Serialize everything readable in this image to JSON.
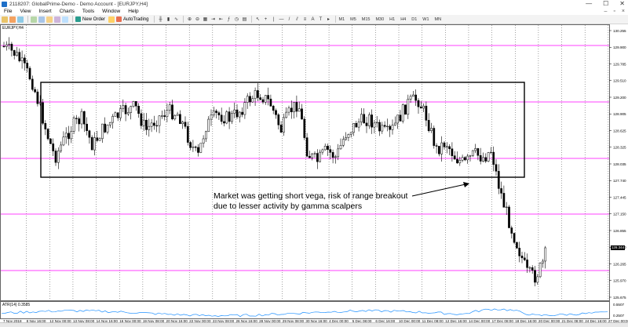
{
  "window": {
    "title": "2118207: GlobalPrime-Demo - Demo Account - [EURJPY,H4]",
    "buttons": [
      "—",
      "☐",
      "✕"
    ]
  },
  "menu": [
    "File",
    "View",
    "Insert",
    "Charts",
    "Tools",
    "Window",
    "Help"
  ],
  "toolbar": {
    "new_order": "New Order",
    "auto_trading": "AutoTrading",
    "timeframes": [
      "M1",
      "M5",
      "M15",
      "M30",
      "H1",
      "H4",
      "D1",
      "W1",
      "MN"
    ]
  },
  "chart": {
    "symbol_label": "EURJPY,H4",
    "indicator_label": "ATR(14) 0.3585",
    "price_ticks": [
      "130.255",
      "129.900",
      "129.785",
      "129.510",
      "129.200",
      "128.905",
      "128.625",
      "128.325",
      "128.035",
      "127.740",
      "127.445",
      "127.150",
      "126.855",
      "126.560",
      "126.265",
      "125.970",
      "125.675"
    ],
    "current_price": "126.344",
    "indicator_ticks": [
      "0.5507",
      "0.2507"
    ],
    "time_ticks": [
      "7 Nov 2018",
      "8 Nov 16:00",
      "12 Nov 00:00",
      "13 Nov 08:00",
      "14 Nov 16:00",
      "16 Nov 00:00",
      "19 Nov 08:00",
      "20 Nov 16:00",
      "22 Nov 00:00",
      "23 Nov 08:00",
      "26 Nov 16:00",
      "28 Nov 00:00",
      "29 Nov 08:00",
      "30 Nov 16:00",
      "4 Dec 00:00",
      "5 Dec 08:00",
      "6 Dec 16:00",
      "10 Dec 00:00",
      "11 Dec 08:00",
      "12 Dec 16:00",
      "14 Dec 00:00",
      "17 Dec 08:00",
      "18 Dec 16:00",
      "20 Dec 00:00",
      "21 Dec 08:00",
      "24 Dec 16:00",
      "27 Dec 00:00"
    ],
    "annotation_line1": "Market was getting short vega, risk of range breakout",
    "annotation_line2": "due to lesser activity by gamma scalpers",
    "colors": {
      "bull_candle": "#ffffff",
      "bear_candle": "#000000",
      "horizontal_lines": "#ff00ff",
      "indicator_line": "#1e90ff",
      "range_box": "#000000"
    }
  }
}
